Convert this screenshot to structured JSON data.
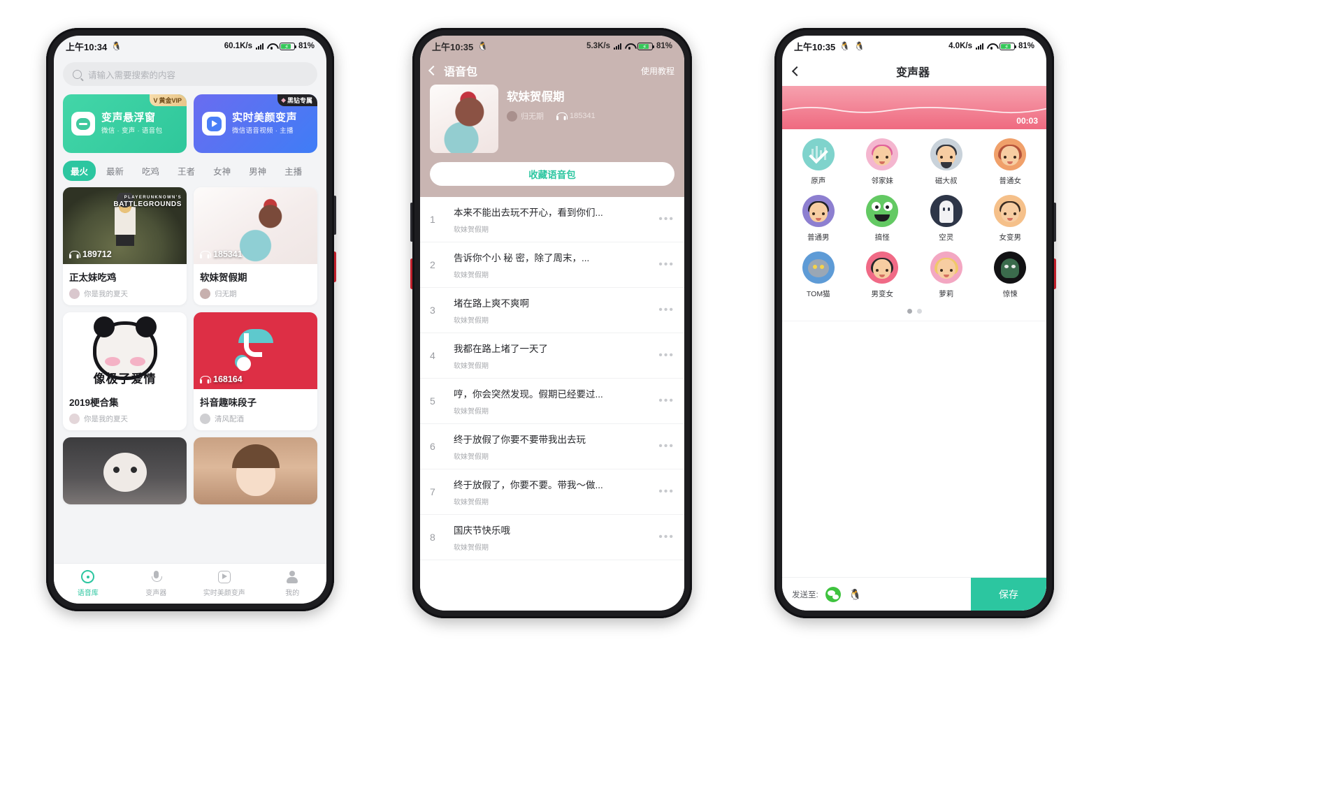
{
  "phone1": {
    "status": {
      "time": "上午10:34",
      "qq_icon": "qq-penguin-icon",
      "speed": "60.1K/s",
      "battery": "81",
      "battery_unit": "%"
    },
    "search": {
      "placeholder": "请输入需要搜索的内容",
      "icon": "search-icon"
    },
    "promos": [
      {
        "title": "变声悬浮窗",
        "subtitle": "微信 · 变声 · 语音包",
        "badge": "黄金VIP",
        "badge_mark": "V",
        "icon": "chat-bubble-icon",
        "color": "#2fc79b"
      },
      {
        "title": "实时美颜变声",
        "subtitle": "微信语音视频 · 主播",
        "badge": "黑钻专属",
        "badge_mark": "◆",
        "icon": "video-play-icon",
        "color": "#3f7df6"
      }
    ],
    "tabs": [
      {
        "label": "最火",
        "active": true
      },
      {
        "label": "最新",
        "active": false
      },
      {
        "label": "吃鸡",
        "active": false
      },
      {
        "label": "王者",
        "active": false
      },
      {
        "label": "女神",
        "active": false
      },
      {
        "label": "男神",
        "active": false
      },
      {
        "label": "主播",
        "active": false
      }
    ],
    "cards": [
      {
        "title": "正太妹吃鸡",
        "author": "你是我的夏天",
        "plays": "189712",
        "art": "art-pubg",
        "overlay_top": "PLAYERUNKNOWN'S",
        "overlay_main": "BATTLEGROUNDS"
      },
      {
        "title": "软妹贺假期",
        "author": "归无期",
        "plays": "185341",
        "art": "art-girl",
        "overlay_top": "",
        "overlay_main": ""
      },
      {
        "title": "2019梗合集",
        "author": "你是我的夏天",
        "plays": "",
        "art": "art-panda",
        "overlay_top": "",
        "overlay_main": "像极了爱情"
      },
      {
        "title": "抖音趣味段子",
        "author": "清风配酒",
        "plays": "168164",
        "art": "art-tiktok",
        "overlay_top": "",
        "overlay_main": ""
      },
      {
        "title": "",
        "author": "",
        "plays": "",
        "art": "art-sheep",
        "overlay_top": "",
        "overlay_main": ""
      },
      {
        "title": "",
        "author": "",
        "plays": "",
        "art": "art-face",
        "overlay_top": "",
        "overlay_main": ""
      }
    ],
    "tabbar": [
      {
        "label": "语音库",
        "icon": "voice-library-icon",
        "active": true
      },
      {
        "label": "变声器",
        "icon": "microphone-icon",
        "active": false
      },
      {
        "label": "实时美颜变声",
        "icon": "video-play-icon",
        "active": false
      },
      {
        "label": "我的",
        "icon": "profile-icon",
        "active": false
      }
    ]
  },
  "phone2": {
    "status": {
      "time": "上午10:35",
      "qq_icon": "qq-penguin-icon",
      "speed": "5.3K/s",
      "battery": "81",
      "battery_unit": "%"
    },
    "nav": {
      "back_icon": "back-chevron-icon",
      "title": "语音包",
      "help": "使用教程"
    },
    "pack": {
      "title": "软妹贺假期",
      "author": "归无期",
      "plays": "185341",
      "plays_icon": "headphone-icon",
      "fav_button": "收藏语音包"
    },
    "list": [
      {
        "n": "1",
        "text": "本来不能出去玩不开心，看到你们...",
        "sub": "软妹贺假期"
      },
      {
        "n": "2",
        "text": "告诉你个小 秘 密，除了周末，...",
        "sub": "软妹贺假期"
      },
      {
        "n": "3",
        "text": "堵在路上爽不爽啊",
        "sub": "软妹贺假期"
      },
      {
        "n": "4",
        "text": "我都在路上堵了一天了",
        "sub": "软妹贺假期"
      },
      {
        "n": "5",
        "text": "哼，你会突然发现。假期已经要过...",
        "sub": "软妹贺假期"
      },
      {
        "n": "6",
        "text": "终于放假了你要不要带我出去玩",
        "sub": "软妹贺假期"
      },
      {
        "n": "7",
        "text": "终于放假了，你要不要。带我～做...",
        "sub": "软妹贺假期"
      },
      {
        "n": "8",
        "text": "国庆节快乐哦",
        "sub": "软妹贺假期"
      }
    ],
    "more_icon": "more-dots-icon"
  },
  "phone3": {
    "status": {
      "time": "上午10:35",
      "qq_icon": "qq-penguin-icon",
      "qq_icon2": "qq-penguin-icon",
      "speed": "4.0K/s",
      "battery": "81",
      "battery_unit": "%"
    },
    "nav": {
      "back_icon": "back-chevron-icon",
      "title": "变声器"
    },
    "waveform": {
      "duration": "00:03",
      "color": "#ef6a80"
    },
    "voices": [
      {
        "label": "原声",
        "cls": "f-orig",
        "hair": "",
        "bg": "#7fd3cc"
      },
      {
        "label": "邻家妹",
        "cls": "",
        "hair": "#e0629a",
        "bg": "#f4b6cf"
      },
      {
        "label": "磁大叔",
        "cls": "",
        "hair": "#33353c",
        "bg": "#c9d2da"
      },
      {
        "label": "普通女",
        "cls": "",
        "hair": "#b5533a",
        "bg": "#f0a06a"
      },
      {
        "label": "普通男",
        "cls": "",
        "hair": "#1f2024",
        "bg": "#8d7fd0"
      },
      {
        "label": "搞怪",
        "cls": "",
        "hair": "#3fa83f",
        "bg": "#63c963"
      },
      {
        "label": "空灵",
        "cls": "",
        "hair": "#f2f2f4",
        "bg": "#2e3648"
      },
      {
        "label": "女变男",
        "cls": "",
        "hair": "#3a2c22",
        "bg": "#f5c08a"
      },
      {
        "label": "TOM猫",
        "cls": "",
        "hair": "#9aa7b5",
        "bg": "#5e9bd6"
      },
      {
        "label": "男变女",
        "cls": "",
        "hair": "#26272b",
        "bg": "#f06a86"
      },
      {
        "label": "萝莉",
        "cls": "",
        "hair": "#f0c86a",
        "bg": "#f3a7c2"
      },
      {
        "label": "惊悚",
        "cls": "",
        "hair": "#2a2a2e",
        "bg": "#121214"
      }
    ],
    "pager": [
      {
        "on": true
      },
      {
        "on": false
      }
    ],
    "send": {
      "label": "发送至:",
      "wechat_icon": "wechat-icon",
      "qq_icon": "qq-icon",
      "save_label": "保存"
    }
  }
}
